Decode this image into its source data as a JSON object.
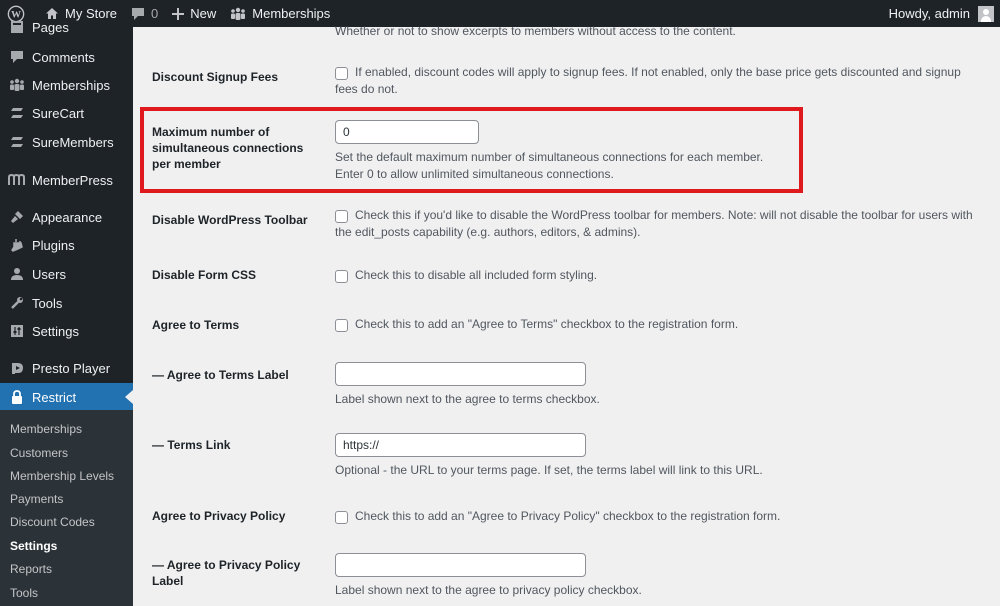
{
  "admin_bar": {
    "site_name": "My Store",
    "comments_count": "0",
    "new_label": "New",
    "memberships_label": "Memberships",
    "greeting": "Howdy, admin"
  },
  "sidebar": {
    "items": [
      {
        "label": "Pages",
        "icon": "pages-icon"
      },
      {
        "label": "Comments",
        "icon": "comments-icon"
      },
      {
        "label": "Memberships",
        "icon": "memberships-icon"
      },
      {
        "label": "SureCart",
        "icon": "surecart-icon"
      },
      {
        "label": "SureMembers",
        "icon": "suremembers-icon"
      },
      {
        "label": "MemberPress",
        "icon": "memberpress-icon"
      },
      {
        "label": "Appearance",
        "icon": "appearance-icon"
      },
      {
        "label": "Plugins",
        "icon": "plugins-icon"
      },
      {
        "label": "Users",
        "icon": "users-icon"
      },
      {
        "label": "Tools",
        "icon": "tools-icon"
      },
      {
        "label": "Settings",
        "icon": "settings-icon"
      },
      {
        "label": "Presto Player",
        "icon": "presto-player-icon"
      },
      {
        "label": "Restrict",
        "icon": "lock-icon",
        "active": true
      }
    ],
    "submenu": [
      {
        "label": "Memberships"
      },
      {
        "label": "Customers"
      },
      {
        "label": "Membership Levels"
      },
      {
        "label": "Payments"
      },
      {
        "label": "Discount Codes"
      },
      {
        "label": "Settings",
        "current": true
      },
      {
        "label": "Reports"
      },
      {
        "label": "Tools"
      }
    ]
  },
  "settings": {
    "excerpts_desc": "Whether or not to show excerpts to members without access to the content.",
    "discount_signup": {
      "label": "Discount Signup Fees",
      "desc": "If enabled, discount codes will apply to signup fees. If not enabled, only the base price gets discounted and signup fees do not.",
      "checked": false
    },
    "max_connections": {
      "label": "Maximum number of simultaneous connections per member",
      "value": "0",
      "desc1": "Set the default maximum number of simultaneous connections for each member.",
      "desc2": "Enter 0 to allow unlimited simultaneous connections."
    },
    "disable_toolbar": {
      "label": "Disable WordPress Toolbar",
      "desc": "Check this if you'd like to disable the WordPress toolbar for members. Note: will not disable the toolbar for users with the edit_posts capability (e.g. authors, editors, & admins).",
      "checked": false
    },
    "disable_form_css": {
      "label": "Disable Form CSS",
      "desc": "Check this to disable all included form styling.",
      "checked": false
    },
    "agree_terms": {
      "label": "Agree to Terms",
      "desc": "Check this to add an \"Agree to Terms\" checkbox to the registration form.",
      "checked": false
    },
    "agree_terms_label": {
      "label": "— Agree to Terms Label",
      "value": "",
      "desc": "Label shown next to the agree to terms checkbox."
    },
    "terms_link": {
      "label": "— Terms Link",
      "value": "https://",
      "desc": "Optional - the URL to your terms page. If set, the terms label will link to this URL."
    },
    "agree_privacy": {
      "label": "Agree to Privacy Policy",
      "desc": "Check this to add an \"Agree to Privacy Policy\" checkbox to the registration form.",
      "checked": false
    },
    "agree_privacy_label": {
      "label": "— Agree to Privacy Policy Label",
      "value": "",
      "desc": "Label shown next to the agree to privacy policy checkbox."
    }
  },
  "colors": {
    "admin_bar_bg": "#1d2327",
    "active_menu": "#2271b1",
    "highlight_border": "#e0191e"
  }
}
